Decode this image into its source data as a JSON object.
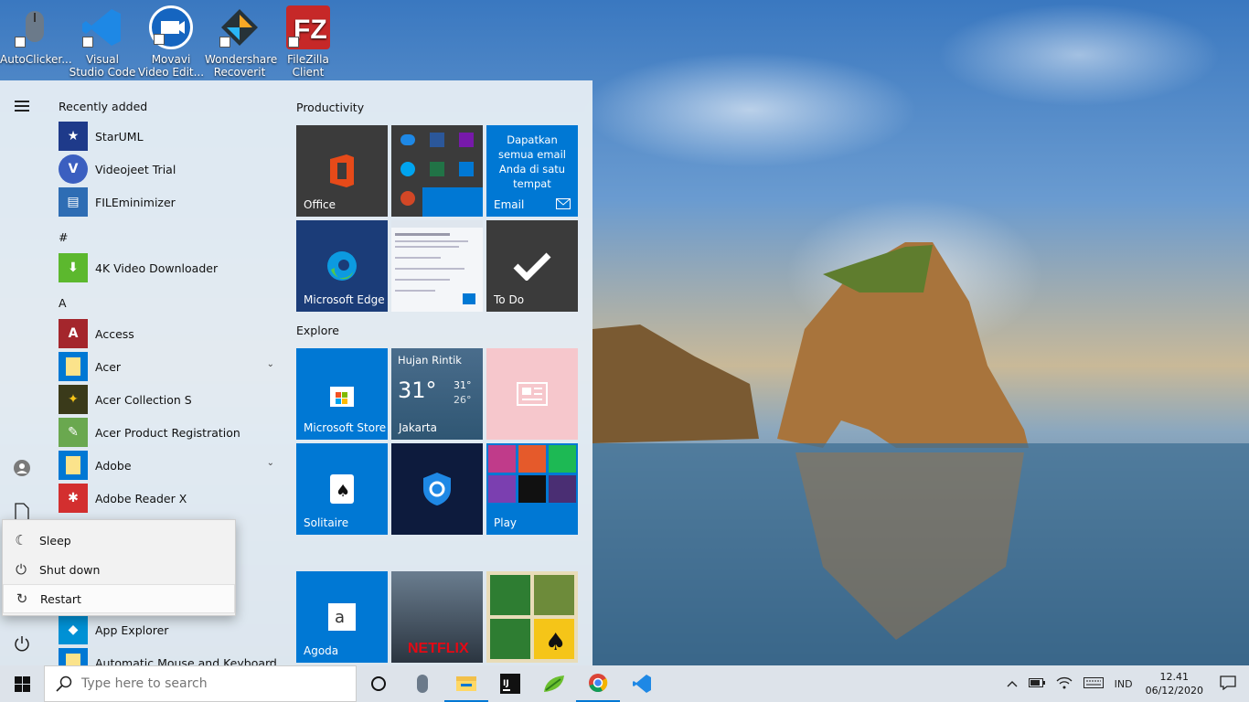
{
  "desktop_icons": [
    {
      "label": "AutoClicker...",
      "icon": "mouse-icon",
      "color": "#5a6b7c"
    },
    {
      "label": "Visual Studio Code",
      "icon": "vscode-icon",
      "color": "#1e88e5"
    },
    {
      "label": "Movavi Video Edit...",
      "icon": "movavi-icon",
      "color": "#1565c0"
    },
    {
      "label": "Wondershare Recoverit",
      "icon": "recoverit-icon",
      "color": "#263238"
    },
    {
      "label": "FileZilla Client",
      "icon": "filezilla-icon",
      "color": "#c62828"
    }
  ],
  "start_menu": {
    "recently_added_header": "Recently added",
    "recent": [
      {
        "label": "StarUML",
        "icon": "staruml-icon",
        "color": "#1e3a8a"
      },
      {
        "label": "Videojeet Trial",
        "icon": "videojeet-icon",
        "color": "#3b5fc0"
      },
      {
        "label": "FILEminimizer",
        "icon": "fileminimizer-icon",
        "color": "#2e6db4"
      }
    ],
    "hash_header": "#",
    "hash_apps": [
      {
        "label": "4K Video Downloader",
        "icon": "4k-downloader-icon",
        "color": "#5cb82e"
      }
    ],
    "a_header": "A",
    "a_apps": [
      {
        "label": "Access",
        "icon": "access-icon",
        "color": "#a4262c",
        "expand": ""
      },
      {
        "label": "Acer",
        "icon": "folder-icon",
        "color": "#0078d4",
        "expand": "⌄"
      },
      {
        "label": "Acer Collection S",
        "icon": "acer-collection-icon",
        "color": "#3a3a1a",
        "expand": ""
      },
      {
        "label": "Acer Product Registration",
        "icon": "acer-registration-icon",
        "color": "#6aa84f",
        "expand": ""
      },
      {
        "label": "Adobe",
        "icon": "folder-icon",
        "color": "#0078d4",
        "expand": "⌄"
      },
      {
        "label": "Adobe Reader X",
        "icon": "adobe-reader-icon",
        "color": "#d32f2f",
        "expand": ""
      },
      {
        "label": "App Explorer",
        "icon": "app-explorer-icon",
        "color": "#0091d5",
        "expand": ""
      },
      {
        "label": "Automatic Mouse and Keyboard",
        "icon": "folder-icon",
        "color": "#0078d4",
        "expand": "⌄"
      }
    ],
    "productivity_header": "Productivity",
    "explore_header": "Explore",
    "tiles": {
      "office": "Office",
      "email_text": "Dapatkan semua email Anda di satu tempat",
      "email": "Email",
      "edge": "Microsoft Edge",
      "todo": "To Do",
      "store": "Microsoft Store",
      "weather_desc": "Hujan Rintik",
      "weather_temp": "31°",
      "weather_high": "31°",
      "weather_low": "26°",
      "weather_city": "Jakarta",
      "solitaire": "Solitaire",
      "play": "Play",
      "agoda": "Agoda",
      "netflix": "NETFLIX"
    }
  },
  "power_menu": {
    "items": [
      {
        "label": "Sleep",
        "glyph": "☾"
      },
      {
        "label": "Shut down",
        "glyph": "⏻"
      },
      {
        "label": "Restart",
        "glyph": "↻"
      }
    ]
  },
  "taskbar": {
    "search_placeholder": "Type here to search",
    "tray_lang": "IND",
    "time": "12.41",
    "date": "06/12/2020"
  }
}
